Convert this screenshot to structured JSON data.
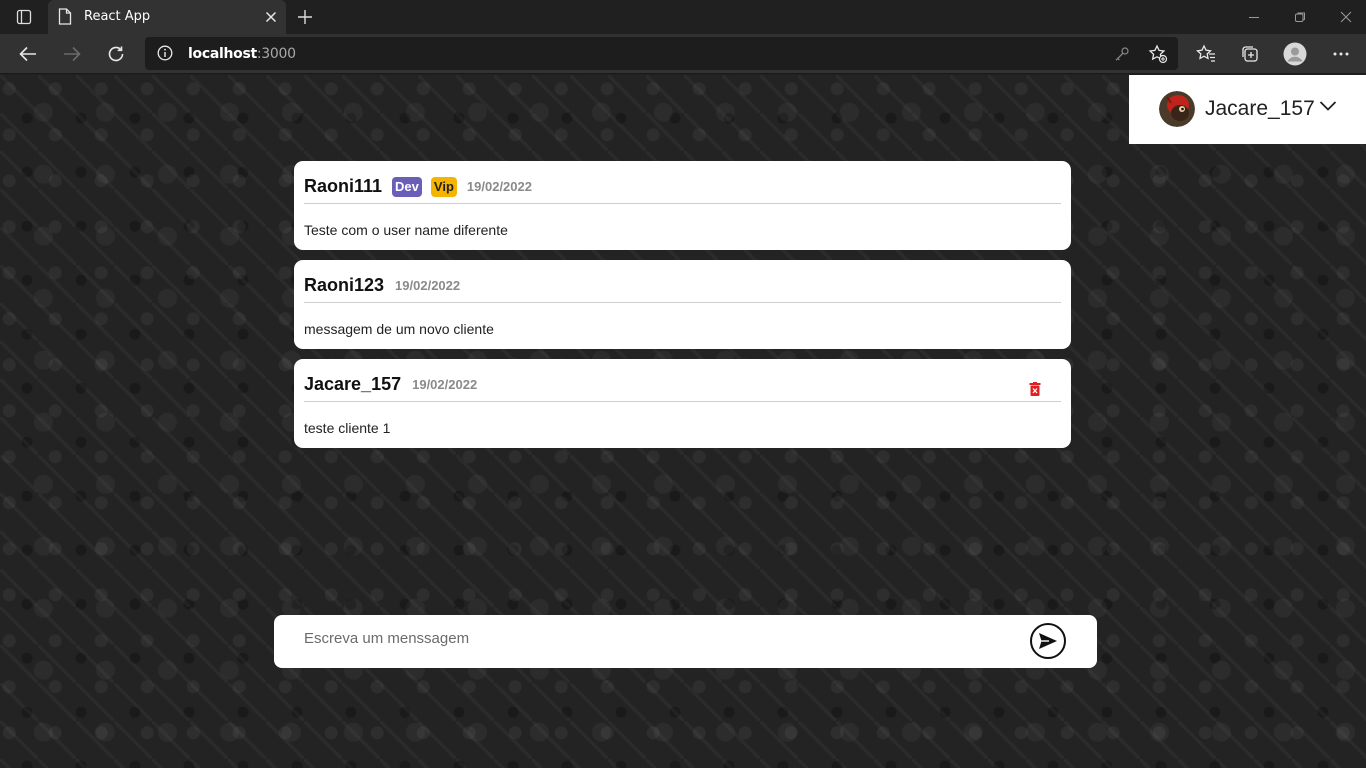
{
  "browser": {
    "tab_title": "React App",
    "url_host": "localhost",
    "url_port": ":3000"
  },
  "user_menu": {
    "username": "Jacare_157"
  },
  "messages": [
    {
      "author": "Raoni111",
      "badges": [
        "Dev",
        "Vip"
      ],
      "date": "19/02/2022",
      "text": "Teste com o user name diferente",
      "deletable": false
    },
    {
      "author": "Raoni123",
      "badges": [],
      "date": "19/02/2022",
      "text": "messagem de um novo cliente",
      "deletable": false
    },
    {
      "author": "Jacare_157",
      "badges": [],
      "date": "19/02/2022",
      "text": "teste cliente 1",
      "deletable": true
    }
  ],
  "composer": {
    "placeholder": "Escreva um menssagem"
  },
  "colors": {
    "dev_badge": "#6a5fb8",
    "vip_badge": "#f5b400",
    "delete_icon": "#e02020"
  }
}
